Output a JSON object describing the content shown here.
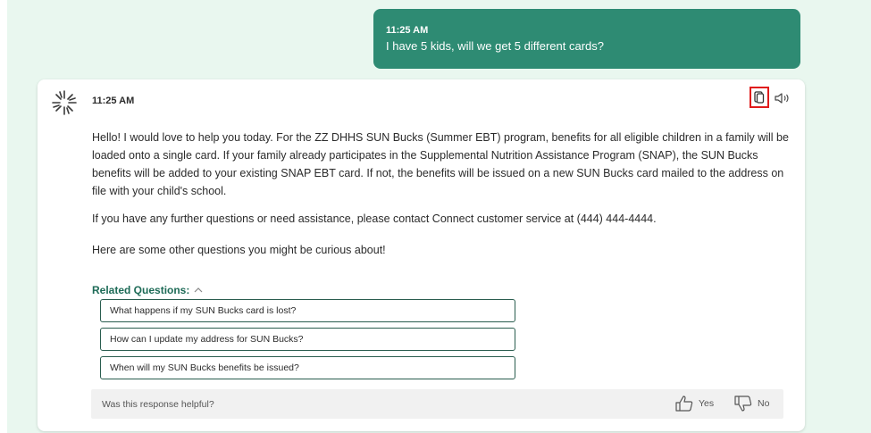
{
  "user_message": {
    "time": "11:25 AM",
    "text": "I have 5 kids, will we get 5 different cards?"
  },
  "bot_message": {
    "time": "11:25 AM",
    "paragraphs": [
      "Hello! I would love to help you today. For the ZZ DHHS SUN Bucks (Summer EBT) program, benefits for all eligible children in a family will be loaded onto a single card. If your family already participates in the Supplemental Nutrition Assistance Program (SNAP), the SUN Bucks benefits will be added to your existing SNAP EBT card. If not, the benefits will be issued on a new SUN Bucks card mailed to the address on file with your child's school.",
      "If you have any further questions or need assistance, please contact Connect customer service at (444) 444-4444.",
      "Here are some other questions you might be curious about!"
    ],
    "icons": {
      "copy": "copy-icon",
      "speaker": "speaker-icon"
    }
  },
  "related": {
    "title": "Related Questions:",
    "questions": [
      "What happens if my SUN Bucks card is lost?",
      "How can I update my address for SUN Bucks?",
      "When will my SUN Bucks benefits be issued?"
    ]
  },
  "feedback": {
    "question": "Was this response helpful?",
    "yes_label": "Yes",
    "no_label": "No"
  },
  "colors": {
    "background": "#e9f7ef",
    "user_bubble": "#2e8b73",
    "accent_text": "#1e6b57",
    "highlight_border": "#e01b1b"
  }
}
